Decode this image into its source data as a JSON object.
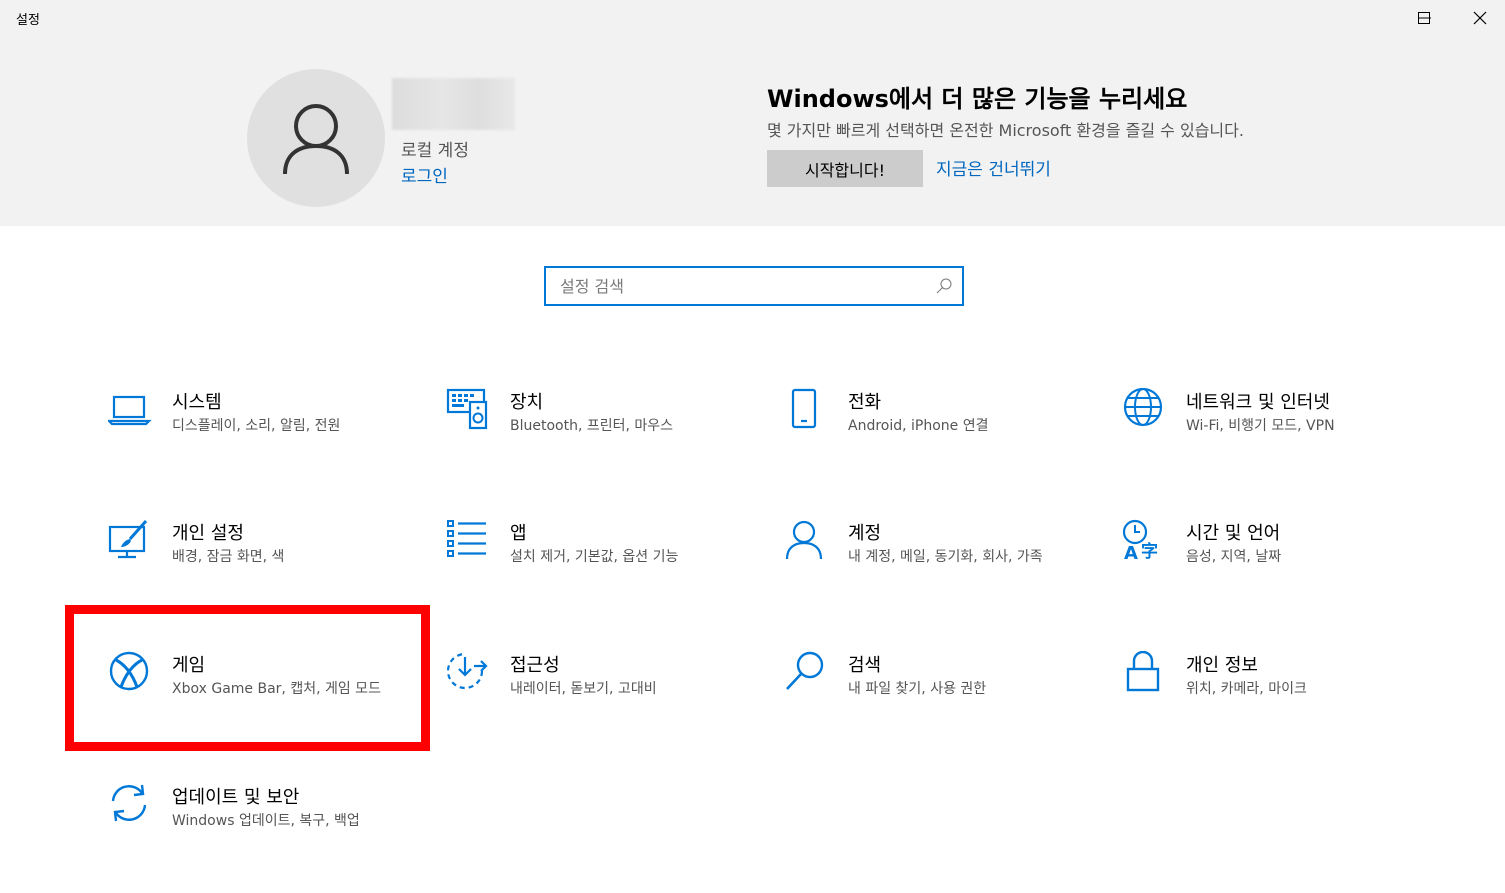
{
  "window": {
    "title": "설정"
  },
  "header": {
    "account_type": "로컬 계정",
    "login_link": "로그인",
    "promo_title": "Windows에서 더 많은 기능을 누리세요",
    "promo_subtitle": "몇 가지만 빠르게 선택하면 온전한 Microsoft 환경을 즐길 수 있습니다.",
    "start_button": "시작합니다!",
    "skip_link": "지금은 건너뛰기"
  },
  "search": {
    "placeholder": "설정 검색",
    "value": ""
  },
  "categories": [
    {
      "name": "시스템",
      "desc": "디스플레이, 소리, 알림, 전원",
      "icon": "laptop-icon"
    },
    {
      "name": "장치",
      "desc": "Bluetooth, 프린터, 마우스",
      "icon": "devices-icon"
    },
    {
      "name": "전화",
      "desc": "Android, iPhone 연결",
      "icon": "phone-icon"
    },
    {
      "name": "네트워크 및 인터넷",
      "desc": "Wi-Fi, 비행기 모드, VPN",
      "icon": "globe-icon"
    },
    {
      "name": "개인 설정",
      "desc": "배경, 잠금 화면, 색",
      "icon": "personalization-icon"
    },
    {
      "name": "앱",
      "desc": "설치 제거, 기본값, 옵션 기능",
      "icon": "apps-list-icon"
    },
    {
      "name": "계정",
      "desc": "내 계정, 메일, 동기화, 회사, 가족",
      "icon": "person-icon"
    },
    {
      "name": "시간 및 언어",
      "desc": "음성, 지역, 날짜",
      "icon": "time-language-icon"
    },
    {
      "name": "게임",
      "desc": "Xbox Game Bar, 캡처, 게임 모드",
      "icon": "xbox-icon"
    },
    {
      "name": "접근성",
      "desc": "내레이터, 돋보기, 고대비",
      "icon": "accessibility-icon"
    },
    {
      "name": "검색",
      "desc": "내 파일 찾기, 사용 권한",
      "icon": "search-magnifier-icon"
    },
    {
      "name": "개인 정보",
      "desc": "위치, 카메라, 마이크",
      "icon": "lock-icon"
    },
    {
      "name": "업데이트 및 보안",
      "desc": "Windows 업데이트, 복구, 백업",
      "icon": "update-sync-icon"
    }
  ],
  "colors": {
    "accent": "#0078d7",
    "link": "#0067c0",
    "highlight": "#ff0000",
    "header_bg": "#f2f2f2"
  }
}
